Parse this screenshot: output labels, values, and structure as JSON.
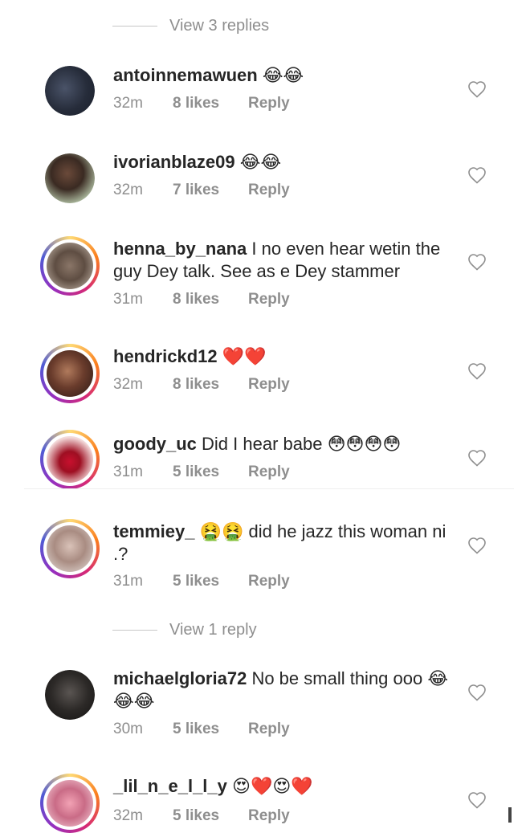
{
  "view_replies_top": "View 3 replies",
  "view_replies_mid": "View 1 reply",
  "comments": [
    {
      "user": "antoinnemawuen",
      "text": "😂😂",
      "time": "32m",
      "likes": "8 likes",
      "reply": "Reply"
    },
    {
      "user": "ivorianblaze09",
      "text": "😂😂",
      "time": "32m",
      "likes": "7 likes",
      "reply": "Reply"
    },
    {
      "user": "henna_by_nana",
      "text": "I no even hear wetin the guy Dey talk. See as e Dey stammer",
      "time": "31m",
      "likes": "8 likes",
      "reply": "Reply"
    },
    {
      "user": "hendrickd12",
      "text": "❤️❤️",
      "time": "32m",
      "likes": "8 likes",
      "reply": "Reply"
    },
    {
      "user": "goody_uc",
      "text": "Did I hear babe 😳😳😳😳",
      "time": "31m",
      "likes": "5 likes",
      "reply": "Reply"
    },
    {
      "user": "temmiey_",
      "text": "🤮🤮 did he jazz this woman ni .?",
      "time": "31m",
      "likes": "5 likes",
      "reply": "Reply"
    },
    {
      "user": "michaelgloria72",
      "text": "No be small thing ooo 😂😂😂",
      "time": "30m",
      "likes": "5 likes",
      "reply": "Reply"
    },
    {
      "user": "_lil_n_e_l_l_y",
      "text": "😍❤️😍❤️",
      "time": "32m",
      "likes": "5 likes",
      "reply": "Reply"
    }
  ],
  "colors": {
    "text_primary": "#262626",
    "text_secondary": "#8e8e8e",
    "story_ring": "instagram-gradient"
  },
  "icons": {
    "like": "heart-outline-icon"
  }
}
